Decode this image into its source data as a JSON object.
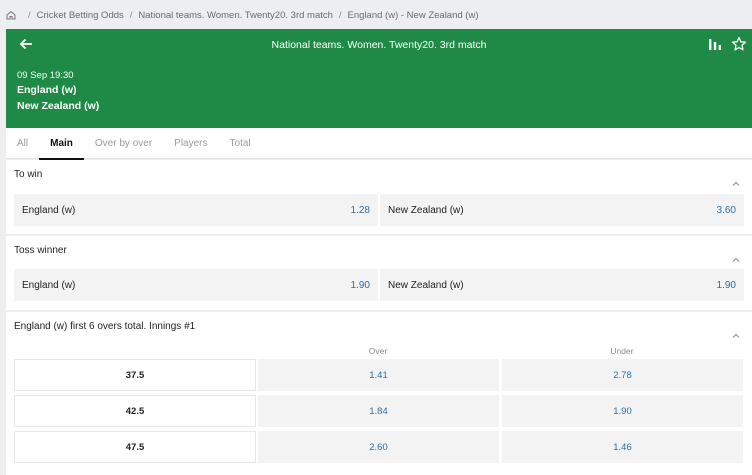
{
  "breadcrumb": {
    "items": [
      "Cricket Betting Odds",
      "National teams. Women. Twenty20. 3rd match",
      "England (w) - New Zealand (w)"
    ],
    "separator": "/"
  },
  "header": {
    "title": "National teams. Women. Twenty20. 3rd match",
    "date": "09 Sep 19:30",
    "team1": "England (w)",
    "team2": "New Zealand (w)",
    "bg_color": "#1e8a45"
  },
  "tabs": [
    {
      "label": "All"
    },
    {
      "label": "Main"
    },
    {
      "label": "Over by over"
    },
    {
      "label": "Players"
    },
    {
      "label": "Total"
    }
  ],
  "markets": {
    "to_win": {
      "title": "To win",
      "home": {
        "name": "England (w)",
        "price": "1.28"
      },
      "away": {
        "name": "New Zealand (w)",
        "price": "3.60"
      }
    },
    "toss_winner": {
      "title": "Toss winner",
      "home": {
        "name": "England (w)",
        "price": "1.90"
      },
      "away": {
        "name": "New Zealand (w)",
        "price": "1.90"
      }
    },
    "first_six": {
      "title": "England (w) first 6 overs total. Innings #1",
      "over_label": "Over",
      "under_label": "Under",
      "rows": [
        {
          "line": "37.5",
          "over": "1.41",
          "under": "2.78"
        },
        {
          "line": "42.5",
          "over": "1.84",
          "under": "1.90"
        },
        {
          "line": "47.5",
          "over": "2.60",
          "under": "1.46"
        }
      ]
    }
  }
}
